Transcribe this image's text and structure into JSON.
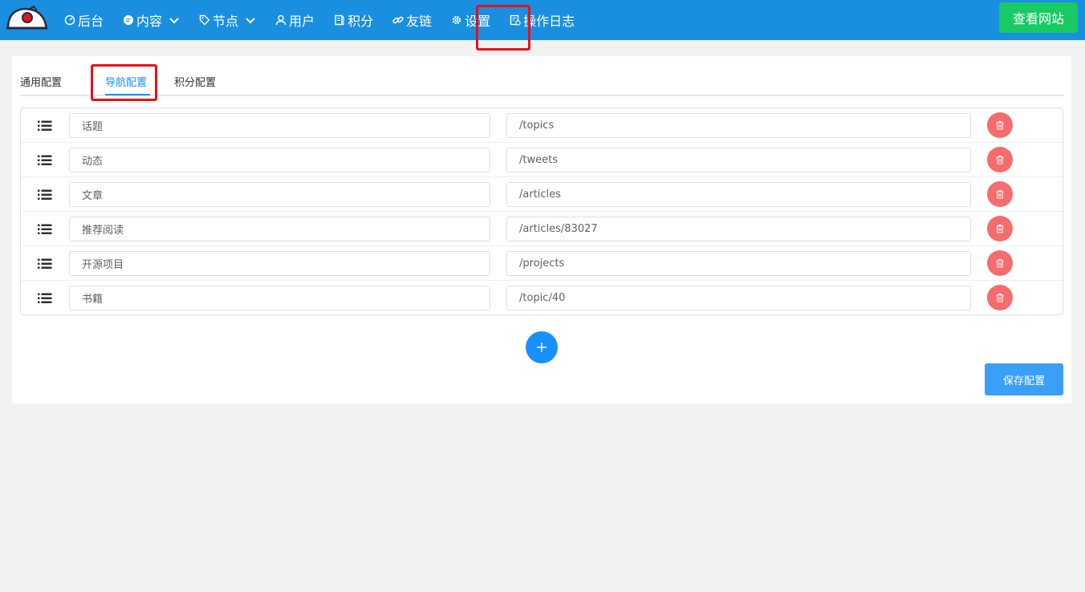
{
  "nav": {
    "items": [
      {
        "label": "后台",
        "icon": "dashboard-icon",
        "dropdown": false
      },
      {
        "label": "内容",
        "icon": "chat-bubble-icon",
        "dropdown": true
      },
      {
        "label": "节点",
        "icon": "tag-icon",
        "dropdown": true
      },
      {
        "label": "用户",
        "icon": "user-icon",
        "dropdown": false
      },
      {
        "label": "积分",
        "icon": "book-icon",
        "dropdown": false
      },
      {
        "label": "友链",
        "icon": "link-icon",
        "dropdown": false
      },
      {
        "label": "设置",
        "icon": "gear-icon",
        "dropdown": false
      },
      {
        "label": "操作日志",
        "icon": "log-icon",
        "dropdown": false
      }
    ],
    "visit_site_label": "查看网站"
  },
  "tabs": [
    {
      "label": "通用配置",
      "active": false
    },
    {
      "label": "导航配置",
      "active": true
    },
    {
      "label": "积分配置",
      "active": false
    }
  ],
  "nav_config": {
    "rows": [
      {
        "name": "话题",
        "url": "/topics"
      },
      {
        "name": "动态",
        "url": "/tweets"
      },
      {
        "name": "文章",
        "url": "/articles"
      },
      {
        "name": "推荐阅读",
        "url": "/articles/83027"
      },
      {
        "name": "开源项目",
        "url": "/projects"
      },
      {
        "name": "书籍",
        "url": "/topic/40"
      }
    ]
  },
  "save_label": "保存配置",
  "colors": {
    "navbar": "#1a8fe0",
    "visit_button": "#18c964",
    "primary": "#1890ff",
    "danger": "#f56c6c",
    "highlight": "#e8101a"
  }
}
